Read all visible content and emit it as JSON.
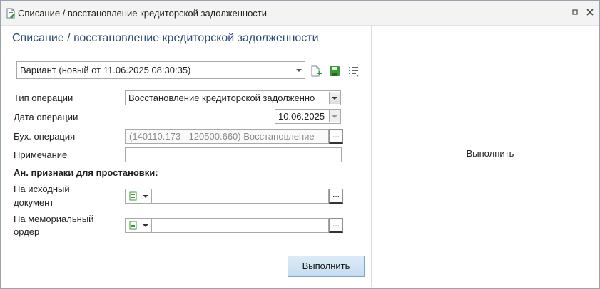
{
  "window": {
    "title": "Списание / восстановление кредиторской задолженности",
    "controls": {
      "restore_icon": "restore-icon",
      "close_icon": "close-icon",
      "close_glyph": "✕",
      "restore_glyph": "▫"
    }
  },
  "form": {
    "title": "Списание / восстановление кредиторской задолженности",
    "variant": {
      "value": "Вариант (новый от 11.06.2025 08:30:35)",
      "icons": [
        "new-document-icon",
        "save-icon",
        "list-settings-icon"
      ]
    },
    "fields": {
      "operation_type": {
        "label": "Тип операции",
        "value": "Восстановление кредиторской задолженно"
      },
      "operation_date": {
        "label": "Дата операции",
        "value": "10.06.2025"
      },
      "accounting_operation": {
        "label": "Бух. операция",
        "value": "(140110.173 - 120500.660) Восстановление",
        "button": "..."
      },
      "note": {
        "label": "Примечание",
        "value": ""
      }
    },
    "analytics_section": {
      "title": "Ан. признаки для простановки:",
      "source_document": {
        "label_line1": "На исходный",
        "label_line2": "документ",
        "value": "",
        "button": "..."
      },
      "memorial_order": {
        "label_line1": "На мемориальный",
        "label_line2": "ордер",
        "value": "",
        "button": "..."
      }
    },
    "execute_button": "Выполнить"
  },
  "right_pane": {
    "text": "Выполнить"
  },
  "colors": {
    "accent_title": "#2b4a77",
    "button_bg": "#c5ddf1",
    "button_border": "#7aa6c9"
  }
}
